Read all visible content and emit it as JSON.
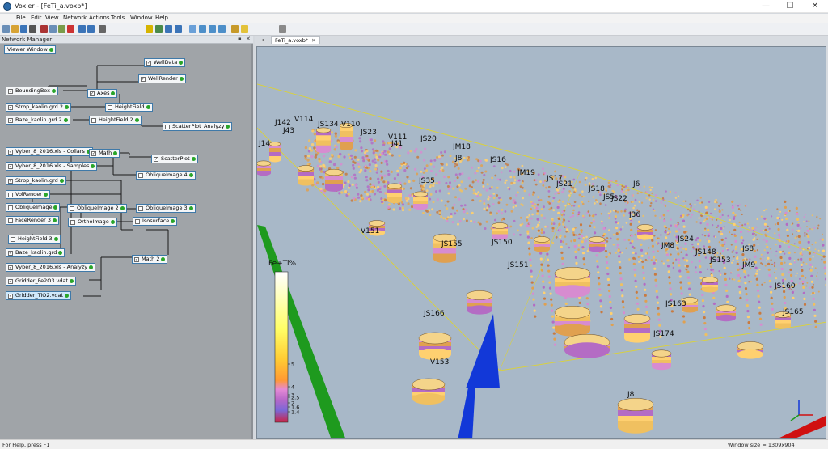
{
  "app": {
    "title": "Voxler - [FeTi_a.voxb*]",
    "controls": {
      "minimize": "—",
      "maximize": "☐",
      "close": "✕"
    }
  },
  "menu": [
    {
      "label": "File",
      "u": "F"
    },
    {
      "label": "Edit",
      "u": "E"
    },
    {
      "label": "View",
      "u": "V"
    },
    {
      "label": "Network",
      "u": "N"
    },
    {
      "label": "Actions",
      "u": "A"
    },
    {
      "label": "Tools",
      "u": "T"
    },
    {
      "label": "Window",
      "u": "W"
    },
    {
      "label": "Help",
      "u": "H"
    }
  ],
  "toolbar": {
    "icons": [
      "new-icon",
      "open-icon",
      "save-icon",
      "print-icon",
      "cut-icon",
      "copy-icon",
      "paste-icon",
      "delete-icon",
      "undo-icon",
      "redo-icon",
      "select-icon",
      "link-icon",
      "rotate-icon",
      "pan-icon",
      "zoom-icon",
      "view-top-icon",
      "view-front-icon",
      "view-side-icon",
      "view-iso-icon",
      "fit-icon",
      "light-icon",
      "module-icon"
    ]
  },
  "network_manager": {
    "title": "Network Manager",
    "pin": "📌",
    "close": "✕",
    "nodes": [
      {
        "id": "viewer-window",
        "label": "Viewer Window",
        "checkbox": false,
        "selected": false
      },
      {
        "id": "welldata",
        "label": "WellData",
        "checkbox": true,
        "checked": true
      },
      {
        "id": "wellrender",
        "label": "WellRender",
        "checkbox": true,
        "checked": true
      },
      {
        "id": "boundingbox",
        "label": "BoundingBox",
        "checkbox": true,
        "checked": true
      },
      {
        "id": "axes",
        "label": "Axes",
        "checkbox": true,
        "checked": true
      },
      {
        "id": "strop-kaolin-2",
        "label": "Strop_kaolin.grd 2",
        "checkbox": true,
        "checked": true
      },
      {
        "id": "heightfield",
        "label": "HeightField",
        "checkbox": true,
        "checked": false
      },
      {
        "id": "baze-kaolin-2",
        "label": "Baze_kaolin.grd 2",
        "checkbox": true,
        "checked": true
      },
      {
        "id": "heightfield-2",
        "label": "HeightField 2",
        "checkbox": true,
        "checked": false
      },
      {
        "id": "scatterplot-analyzy",
        "label": "ScatterPlot_Analyzy",
        "checkbox": true,
        "checked": false
      },
      {
        "id": "vyber-collars",
        "label": "Vyber_8_2016.xls - Collars",
        "checkbox": true,
        "checked": true
      },
      {
        "id": "math",
        "label": "Math",
        "checkbox": true,
        "checked": true
      },
      {
        "id": "scatterplot",
        "label": "ScatterPlot",
        "checkbox": true,
        "checked": true
      },
      {
        "id": "vyber-samples",
        "label": "Vyber_8_2016.xls - Samples",
        "checkbox": true,
        "checked": true
      },
      {
        "id": "obliqueimage-4",
        "label": "ObliqueImage 4",
        "checkbox": true,
        "checked": false
      },
      {
        "id": "strop-kaolin",
        "label": "Strop_kaolin.grd",
        "checkbox": true,
        "checked": true
      },
      {
        "id": "volrender",
        "label": "VolRender",
        "checkbox": true,
        "checked": false
      },
      {
        "id": "obliqueimage",
        "label": "ObliqueImage",
        "checkbox": true,
        "checked": false
      },
      {
        "id": "obliqueimage-2",
        "label": "ObliqueImage 2",
        "checkbox": true,
        "checked": false
      },
      {
        "id": "obliqueimage-3",
        "label": "ObliqueImage 3",
        "checkbox": true,
        "checked": false
      },
      {
        "id": "facerender-3",
        "label": "FaceRender 3",
        "checkbox": true,
        "checked": false
      },
      {
        "id": "orthoimage",
        "label": "OrthoImage",
        "checkbox": true,
        "checked": false
      },
      {
        "id": "isosurface",
        "label": "Isosurface",
        "checkbox": true,
        "checked": false
      },
      {
        "id": "heightfield-3",
        "label": "HeightField 3",
        "checkbox": true,
        "checked": false
      },
      {
        "id": "baze-kaolin",
        "label": "Baze_kaolin.grd",
        "checkbox": true,
        "checked": true
      },
      {
        "id": "math-2",
        "label": "Math 2",
        "checkbox": true,
        "checked": true
      },
      {
        "id": "vyber-analyzy",
        "label": "Vyber_8_2016.xls - Analyzy",
        "checkbox": true,
        "checked": true
      },
      {
        "id": "gridder-fe2o3",
        "label": "Gridder_Fe2O3.vdat",
        "checkbox": true,
        "checked": true
      },
      {
        "id": "gridder-tio2",
        "label": "Gridder_TiO2.vdat",
        "checkbox": true,
        "checked": true,
        "selected": true
      }
    ]
  },
  "document_tab": {
    "label": "FeTi_a.voxb*",
    "close": "✕",
    "menu": "◂"
  },
  "viewer": {
    "well_labels": [
      "J14",
      "J142",
      "V114",
      "J43",
      "JS134",
      "V110",
      "JS23",
      "V111",
      "J41",
      "JS20",
      "JM18",
      "JS16",
      "JS35",
      "J8",
      "JM19",
      "JS17",
      "JS21",
      "JS18",
      "JS5",
      "JS22",
      "J6",
      "V151",
      "JS155",
      "JS150",
      "JS151",
      "J36",
      "JS24",
      "JM8",
      "JS148",
      "JS153",
      "JM9",
      "JS160",
      "JS165",
      "JS166",
      "V153",
      "JS163",
      "JS174",
      "JS8",
      "J8"
    ],
    "legend": {
      "title": "Fe+Ti%",
      "ticks": [
        "5",
        "4",
        "3",
        "2.5",
        "2",
        "1.6",
        "1.4"
      ],
      "colors": [
        "#ffffff",
        "#ffff66",
        "#ffcc33",
        "#ff9933",
        "#e58ad6",
        "#b768c8",
        "#7a68d8",
        "#cc2244"
      ]
    },
    "colors": {
      "background": "#a8b8c8",
      "axis_y": "#1e9a1e",
      "axis_z": "#1238d8",
      "axis_x": "#d01010",
      "bbox": "#d8d040"
    }
  },
  "status": {
    "left": "For Help, press F1",
    "right": "Window size = 1309x904"
  }
}
